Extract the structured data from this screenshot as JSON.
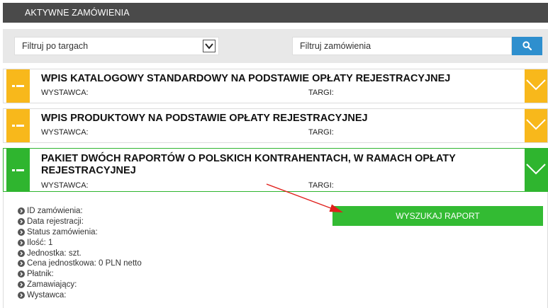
{
  "header": {
    "title": "AKTYWNE ZAMÓWIENIA"
  },
  "filters": {
    "fair_select_value": "Filtruj po targach",
    "order_search_placeholder": "Filtruj zamówienia"
  },
  "orders": [
    {
      "title": "WPIS KATALOGOWY STANDARDOWY NA PODSTAWIE OPŁATY REJESTRACYJNEJ",
      "exhibitor_label": "WYSTAWCA:",
      "fair_label": "TARGI:",
      "status_color": "#f8b81b",
      "expanded": false
    },
    {
      "title": "WPIS PRODUKTOWY NA PODSTAWIE OPŁATY REJESTRACYJNEJ",
      "exhibitor_label": "WYSTAWCA:",
      "fair_label": "TARGI:",
      "status_color": "#f8b81b",
      "expanded": false
    },
    {
      "title": "PAKIET DWÓCH RAPORTÓW O POLSKICH KONTRAHENTACH, W RAMACH OPŁATY REJESTRACYJNEJ",
      "exhibitor_label": "WYSTAWCA:",
      "fair_label": "TARGI:",
      "status_color": "#2fb52f",
      "expanded": true
    }
  ],
  "details": {
    "items": [
      "ID zamówienia:",
      "Data rejestracji:",
      "Status zamówienia:",
      "Ilość: 1",
      "Jednostka: szt.",
      "Cena jednostkowa: 0 PLN netto",
      "Płatnik:",
      "Zamawiający:",
      "Wystawca:"
    ],
    "report_button_label": "WYSZUKAJ RAPORT"
  },
  "colors": {
    "header_bg": "#4a4a4a",
    "pending": "#f8b81b",
    "active": "#2fb52f",
    "search_button": "#2e8fce",
    "annotation_arrow": "#e0201c"
  },
  "icons": {
    "search": "search-icon",
    "dropdown": "chevron-down-icon",
    "expand": "chevron-down-icon",
    "collapse_toggle": "collapse-icon",
    "detail_bullet": "circle-arrow-right-icon"
  }
}
